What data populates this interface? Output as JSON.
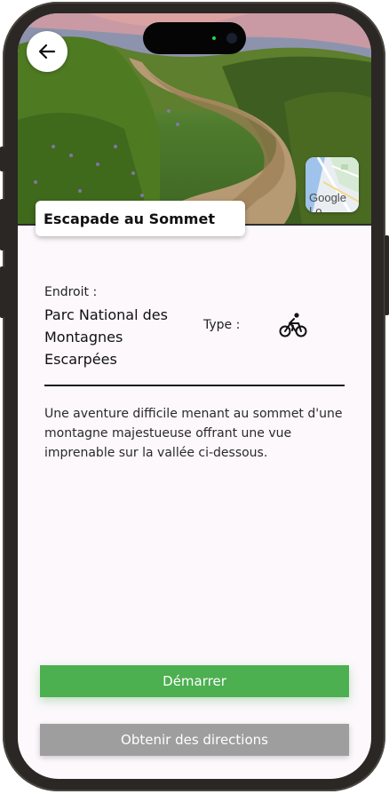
{
  "header": {
    "title": "Escapade au Sommet",
    "back_icon": "arrow-left-icon",
    "map_thumbnail_text": "Google Lo"
  },
  "details": {
    "location_label": "Endroit :",
    "location_value": "Parc National des Montagnes Escarpées",
    "type_label": "Type :",
    "type_icon": "bicycle-icon"
  },
  "description": "Une aventure difficile menant au sommet d'une montagne majestueuse offrant une vue imprenable sur la vallée ci-dessous.",
  "actions": {
    "start_label": "Démarrer",
    "directions_label": "Obtenir des directions"
  },
  "colors": {
    "primary_green": "#4caf50",
    "secondary_gray": "#9e9e9e",
    "background": "#fcf8fc"
  }
}
